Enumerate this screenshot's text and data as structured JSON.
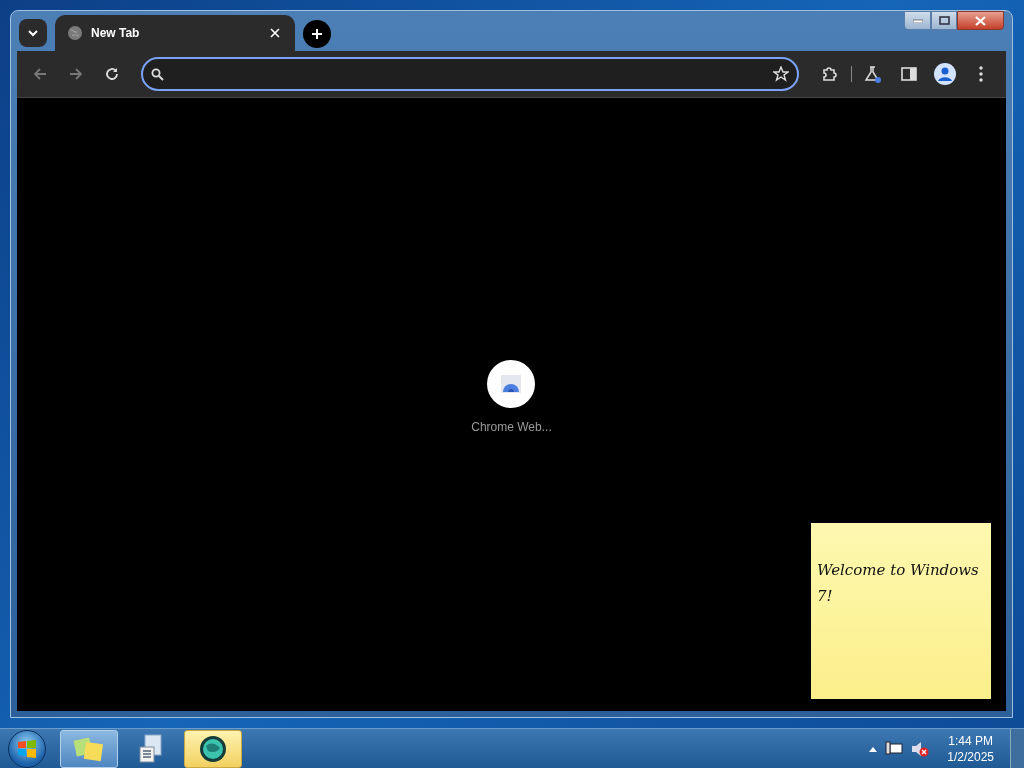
{
  "browser": {
    "tabs": [
      {
        "title": "New Tab",
        "selected": true
      }
    ],
    "shortcut": {
      "label": "Chrome Web..."
    }
  },
  "sticky_note": {
    "text": "Welcome to Windows 7!"
  },
  "taskbar": {
    "apps": [
      {
        "kind": "notes",
        "running": true,
        "selected": false
      },
      {
        "kind": "document",
        "running": false,
        "selected": false
      },
      {
        "kind": "globe",
        "running": true,
        "selected": true
      }
    ],
    "clock": {
      "time": "1:44 PM",
      "date": "1/2/2025"
    }
  }
}
